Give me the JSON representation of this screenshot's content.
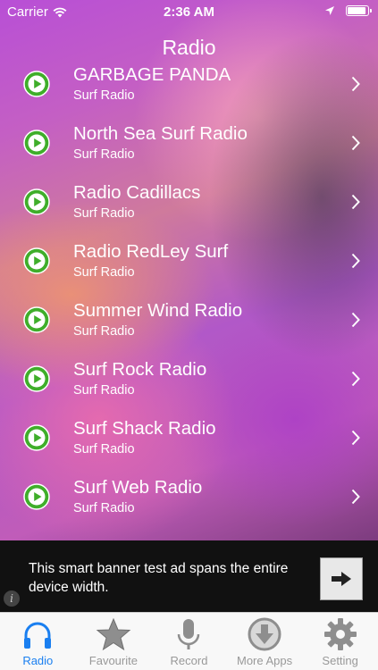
{
  "status_bar": {
    "carrier": "Carrier",
    "time": "2:36 AM"
  },
  "header": {
    "title": "Radio"
  },
  "stations": [
    {
      "name": "GARBAGE PANDA",
      "genre": "Surf Radio"
    },
    {
      "name": "North Sea Surf Radio",
      "genre": "Surf Radio"
    },
    {
      "name": "Radio Cadillacs",
      "genre": "Surf Radio"
    },
    {
      "name": "Radio RedLey Surf",
      "genre": "Surf Radio"
    },
    {
      "name": "Summer Wind Radio",
      "genre": "Surf Radio"
    },
    {
      "name": "Surf Rock Radio",
      "genre": "Surf Radio"
    },
    {
      "name": "Surf Shack Radio",
      "genre": "Surf Radio"
    },
    {
      "name": "Surf Web Radio",
      "genre": "Surf Radio"
    }
  ],
  "ad_banner": {
    "text": "This smart banner test ad spans the entire device width."
  },
  "tabs": [
    {
      "label": "Radio",
      "icon": "headphones-icon",
      "active": true
    },
    {
      "label": "Favourite",
      "icon": "star-icon",
      "active": false
    },
    {
      "label": "Record",
      "icon": "microphone-icon",
      "active": false
    },
    {
      "label": "More Apps",
      "icon": "download-icon",
      "active": false
    },
    {
      "label": "Setting",
      "icon": "gear-icon",
      "active": false
    }
  ],
  "colors": {
    "accent": "#1a7ff0",
    "play_green": "#3fae2a",
    "inactive_tab": "#999999"
  }
}
